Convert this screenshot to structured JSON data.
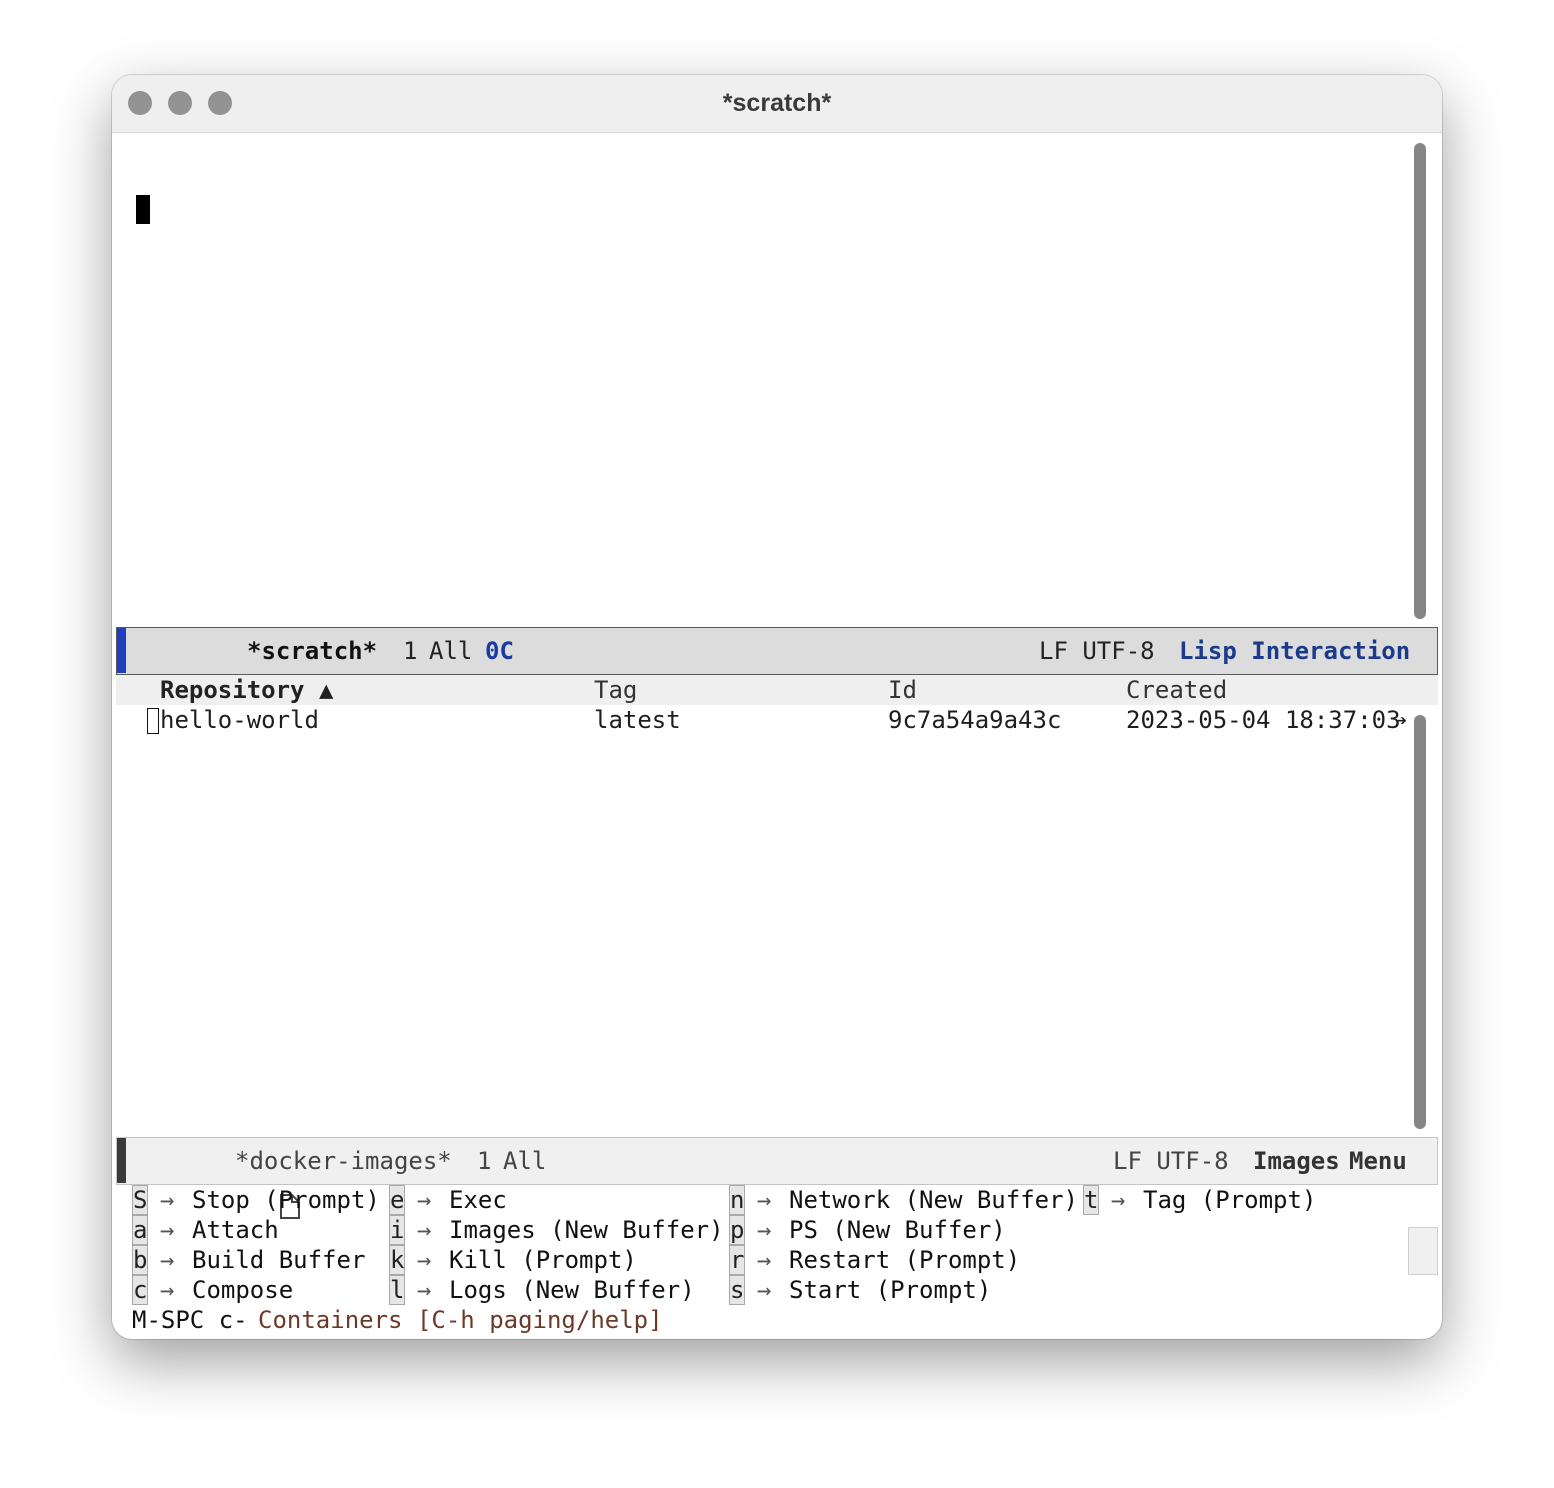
{
  "window": {
    "title": "*scratch*"
  },
  "top_modeline": {
    "buffer": "*scratch*",
    "line": "1",
    "position": "All",
    "column": "0C",
    "eol_encoding": "LF UTF-8",
    "major_mode": "Lisp Interaction"
  },
  "table": {
    "headers": {
      "repository": "Repository ▲",
      "tag": "Tag",
      "id": "Id",
      "created": "Created"
    },
    "rows": [
      {
        "repository": "hello-world",
        "tag": "latest",
        "id": "9c7a54a9a43c",
        "created": "2023-05-04 18:37:03"
      }
    ],
    "truncation_marker": "➔"
  },
  "bottom_modeline": {
    "buffer": "*docker-images*",
    "line": "1",
    "position": "All",
    "eol_encoding": "LF UTF-8",
    "mode_images": "Images",
    "mode_menu": "Menu"
  },
  "which_key": {
    "arrow": "→",
    "items": [
      {
        "key": "S",
        "desc": "Stop (Prompt)"
      },
      {
        "key": "a",
        "desc": "Attach"
      },
      {
        "key": "b",
        "desc": "Build Buffer"
      },
      {
        "key": "c",
        "desc": "Compose"
      },
      {
        "key": "e",
        "desc": "Exec"
      },
      {
        "key": "i",
        "desc": "Images (New Buffer)"
      },
      {
        "key": "k",
        "desc": "Kill (Prompt)"
      },
      {
        "key": "l",
        "desc": "Logs (New Buffer)"
      },
      {
        "key": "n",
        "desc": "Network (New Buffer)"
      },
      {
        "key": "p",
        "desc": "PS (New Buffer)"
      },
      {
        "key": "r",
        "desc": "Restart (Prompt)"
      },
      {
        "key": "s",
        "desc": "Start (Prompt)"
      },
      {
        "key": "t",
        "desc": "Tag (Prompt)"
      }
    ],
    "prefix": "M-SPC c-",
    "prompt": "Containers [C-h paging/help]"
  },
  "colors": {
    "active_accent": "#1f3fbf",
    "column_number": "#1b3aa3",
    "major_mode": "#1b3a8a",
    "modeline_active_bg": "#dcdcdc",
    "modeline_inactive_bg": "#f0f0f0",
    "buffer_icon_orange": "#d3894a",
    "prompt_brown": "#6b3a28"
  }
}
